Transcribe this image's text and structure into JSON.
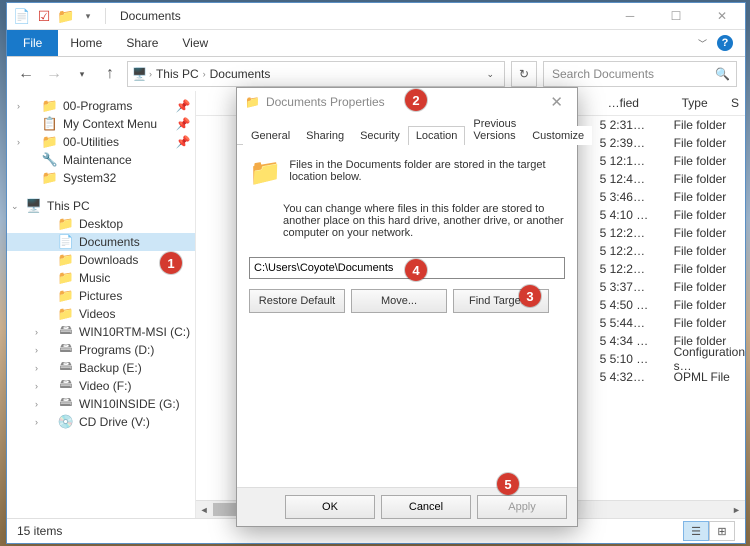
{
  "window": {
    "title": "Documents"
  },
  "ribbon": {
    "file": "File",
    "tabs": [
      "Home",
      "Share",
      "View"
    ]
  },
  "address": {
    "root": "This PC",
    "folder": "Documents"
  },
  "search": {
    "placeholder": "Search Documents"
  },
  "nav": {
    "quick": [
      {
        "label": "00-Programs",
        "icon": "folder"
      },
      {
        "label": "My Context Menu",
        "icon": "menu"
      },
      {
        "label": "00-Utilities",
        "icon": "folder"
      },
      {
        "label": "Maintenance",
        "icon": "wrench"
      },
      {
        "label": "System32",
        "icon": "folder"
      }
    ],
    "this_pc": "This PC",
    "pc_items": [
      {
        "label": "Desktop",
        "icon": "folder"
      },
      {
        "label": "Documents",
        "icon": "doc",
        "sel": true
      },
      {
        "label": "Downloads",
        "icon": "folder"
      },
      {
        "label": "Music",
        "icon": "folder"
      },
      {
        "label": "Pictures",
        "icon": "folder"
      },
      {
        "label": "Videos",
        "icon": "folder"
      },
      {
        "label": "WIN10RTM-MSI (C:)",
        "icon": "drive"
      },
      {
        "label": "Programs (D:)",
        "icon": "drive"
      },
      {
        "label": "Backup (E:)",
        "icon": "drive"
      },
      {
        "label": "Video (F:)",
        "icon": "drive"
      },
      {
        "label": "WIN10INSIDE (G:)",
        "icon": "drive"
      },
      {
        "label": "CD Drive (V:)",
        "icon": "cd"
      }
    ]
  },
  "columns": {
    "modified": "…fied",
    "type": "Type",
    "size_hdr": "S"
  },
  "rows": [
    {
      "date": "5 2:31…",
      "type": "File folder"
    },
    {
      "date": "5 2:39…",
      "type": "File folder"
    },
    {
      "date": "5 12:1…",
      "type": "File folder"
    },
    {
      "date": "5 12:4…",
      "type": "File folder"
    },
    {
      "date": "5 3:46…",
      "type": "File folder"
    },
    {
      "date": "5 4:10 …",
      "type": "File folder"
    },
    {
      "date": "5 12:2…",
      "type": "File folder"
    },
    {
      "date": "5 12:2…",
      "type": "File folder"
    },
    {
      "date": "5 12:2…",
      "type": "File folder"
    },
    {
      "date": "5 3:37…",
      "type": "File folder"
    },
    {
      "date": "5 4:50 …",
      "type": "File folder"
    },
    {
      "date": "5 5:44…",
      "type": "File folder"
    },
    {
      "date": "5 4:34 …",
      "type": "File folder"
    },
    {
      "date": "5 5:10 …",
      "type": "Configuration s…"
    },
    {
      "date": "5 4:32…",
      "type": "OPML File"
    }
  ],
  "status": {
    "items": "15 items"
  },
  "dialog": {
    "title": "Documents Properties",
    "tabs": [
      "General",
      "Sharing",
      "Security",
      "Location",
      "Previous Versions",
      "Customize"
    ],
    "info1": "Files in the Documents folder are stored in the target location below.",
    "info2": "You can change where files in this folder are stored to another place on this hard drive, another drive, or another computer on your network.",
    "path": "C:\\Users\\Coyote\\Documents",
    "restore": "Restore Default",
    "move": "Move...",
    "find": "Find Target...",
    "ok": "OK",
    "cancel": "Cancel",
    "apply": "Apply"
  },
  "callouts": [
    "1",
    "2",
    "3",
    "4",
    "5"
  ]
}
